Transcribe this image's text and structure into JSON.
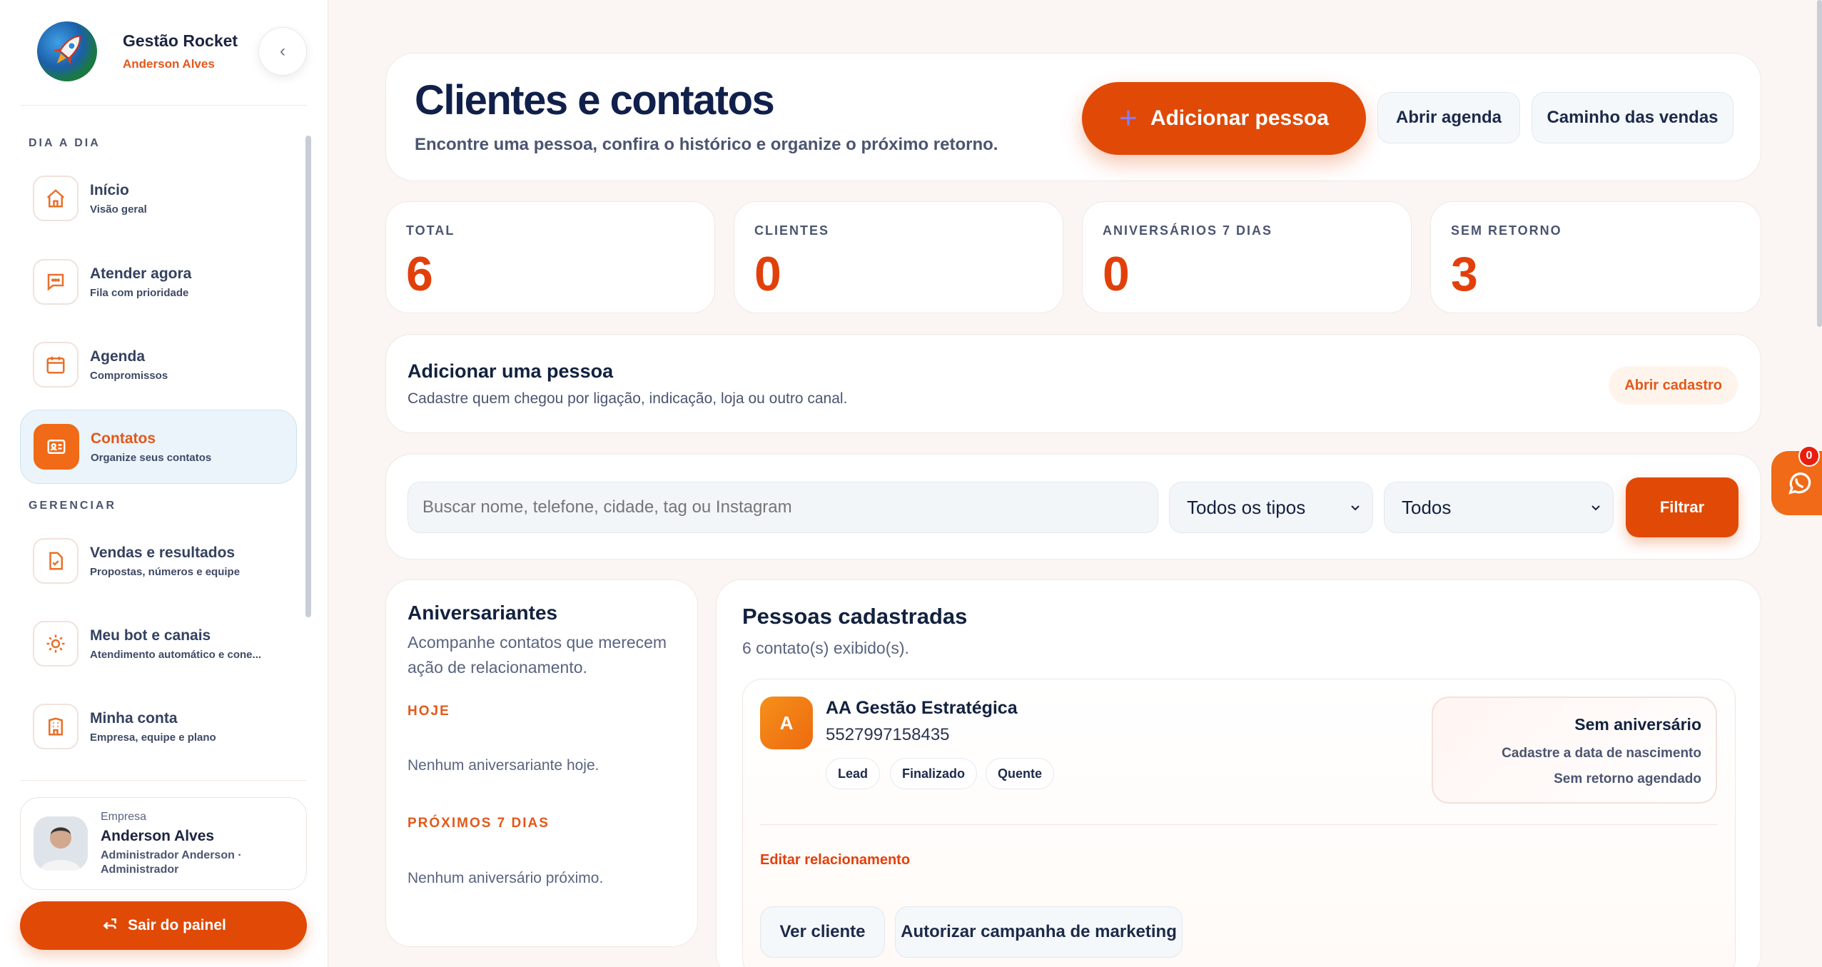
{
  "sidebar": {
    "brand_name": "Gestão Rocket",
    "brand_user": "Anderson Alves",
    "collapse_icon": "‹",
    "section_dia": "DIA A DIA",
    "section_gerenciar": "GERENCIAR",
    "items": [
      {
        "label": "Início",
        "sub": "Visão geral",
        "icon": "home-icon"
      },
      {
        "label": "Atender agora",
        "sub": "Fila com prioridade",
        "icon": "chat-icon"
      },
      {
        "label": "Agenda",
        "sub": "Compromissos",
        "icon": "calendar-icon"
      },
      {
        "label": "Contatos",
        "sub": "Organize seus contatos",
        "icon": "contact-card-icon",
        "active": true
      },
      {
        "label": "Vendas e resultados",
        "sub": "Propostas, números e equipe",
        "icon": "document-check-icon"
      },
      {
        "label": "Meu bot e canais",
        "sub": "Atendimento automático e cone...",
        "icon": "sun-gear-icon"
      },
      {
        "label": "Minha conta",
        "sub": "Empresa, equipe e plano",
        "icon": "building-icon"
      }
    ],
    "profile": {
      "kind": "Empresa",
      "name": "Anderson Alves",
      "role": "Administrador Anderson · Administrador"
    },
    "logout_label": "Sair do painel"
  },
  "header": {
    "title": "Clientes e contatos",
    "subtitle": "Encontre uma pessoa, confira o histórico e organize o próximo retorno.",
    "add_button": "Adicionar pessoa",
    "agenda_button": "Abrir agenda",
    "sales_button": "Caminho das vendas"
  },
  "stats": [
    {
      "label": "TOTAL",
      "value": "6"
    },
    {
      "label": "CLIENTES",
      "value": "0"
    },
    {
      "label": "ANIVERSÁRIOS 7 DIAS",
      "value": "0"
    },
    {
      "label": "SEM RETORNO",
      "value": "3"
    }
  ],
  "add_person": {
    "title": "Adicionar uma pessoa",
    "subtitle": "Cadastre quem chegou por ligação, indicação, loja ou outro canal.",
    "button": "Abrir cadastro"
  },
  "filters": {
    "search_placeholder": "Buscar nome, telefone, cidade, tag ou Instagram",
    "type_select": "Todos os tipos",
    "status_select": "Todos",
    "filter_button": "Filtrar"
  },
  "birthdays": {
    "title": "Aniversariantes",
    "subtitle": "Acompanhe contatos que merecem ação de relacionamento.",
    "today_label": "HOJE",
    "today_empty": "Nenhum aniversariante hoje.",
    "next_label": "PRÓXIMOS 7 DIAS",
    "next_empty": "Nenhum aniversário próximo."
  },
  "people": {
    "title": "Pessoas cadastradas",
    "count_text": "6 contato(s) exibido(s).",
    "first": {
      "initial": "A",
      "name": "AA Gestão Estratégica",
      "phone": "5527997158435",
      "tags": [
        "Lead",
        "Finalizado",
        "Quente"
      ],
      "bday_title": "Sem aniversário",
      "bday_line1": "Cadastre a data de nascimento",
      "bday_line2": "Sem retorno agendado",
      "edit_link": "Editar relacionamento",
      "view_button": "Ver cliente",
      "authorize_button": "Autorizar campanha de marketing"
    }
  },
  "whatsapp": {
    "badge": "0",
    "icon": "whatsapp-icon"
  },
  "colors": {
    "accent": "#e04a06",
    "active_bg": "#eaf4fa",
    "text": "#12213f"
  }
}
